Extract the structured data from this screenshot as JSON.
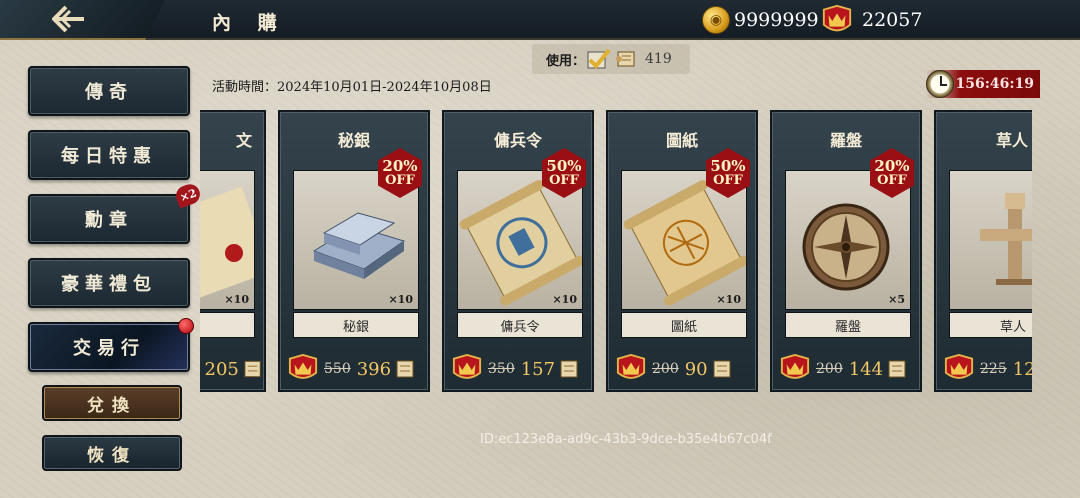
{
  "header": {
    "title": "內 購",
    "gold": "9999999",
    "crowns": "22057"
  },
  "usebar": {
    "label": "使用：",
    "count": "419"
  },
  "event": {
    "time": "活動時間：2024年10月01日-2024年10月08日",
    "countdown": "156:46:19"
  },
  "sidebar": {
    "items": [
      {
        "label": "傳奇"
      },
      {
        "label": "每日特惠"
      },
      {
        "label": "勳章"
      },
      {
        "label": "豪華禮包"
      },
      {
        "label": "交易行"
      }
    ],
    "badge": "×2",
    "exchange": "兌換",
    "restore": "恢復"
  },
  "cards": [
    {
      "title": "文",
      "label": "",
      "qty": "×10",
      "discount_pct": "",
      "discount_off": "",
      "old_price": "",
      "new_price": "205",
      "icon": "scroll-letter-icon"
    },
    {
      "title": "秘銀",
      "label": "秘銀",
      "qty": "×10",
      "discount_pct": "20%",
      "discount_off": "OFF",
      "old_price": "550",
      "new_price": "396",
      "icon": "mithril-ingots-icon"
    },
    {
      "title": "傭兵令",
      "label": "傭兵令",
      "qty": "×10",
      "discount_pct": "50%",
      "discount_off": "OFF",
      "old_price": "350",
      "new_price": "157",
      "icon": "mercenary-scroll-icon"
    },
    {
      "title": "圖紙",
      "label": "圖紙",
      "qty": "×10",
      "discount_pct": "50%",
      "discount_off": "OFF",
      "old_price": "200",
      "new_price": "90",
      "icon": "blueprint-scroll-icon"
    },
    {
      "title": "羅盤",
      "label": "羅盤",
      "qty": "×5",
      "discount_pct": "20%",
      "discount_off": "OFF",
      "old_price": "200",
      "new_price": "144",
      "icon": "compass-icon"
    },
    {
      "title": "草人",
      "label": "草人",
      "qty": "",
      "discount_pct": "",
      "discount_off": "",
      "old_price": "225",
      "new_price": "12",
      "icon": "training-dummy-icon"
    }
  ],
  "id_line": "ID:ec123e8a-ad9c-43b3-9dce-b35e4b67c04f",
  "colors": {
    "price": "#f1c766",
    "discount": "#9a0f14",
    "timer": "#8c0d0d"
  }
}
